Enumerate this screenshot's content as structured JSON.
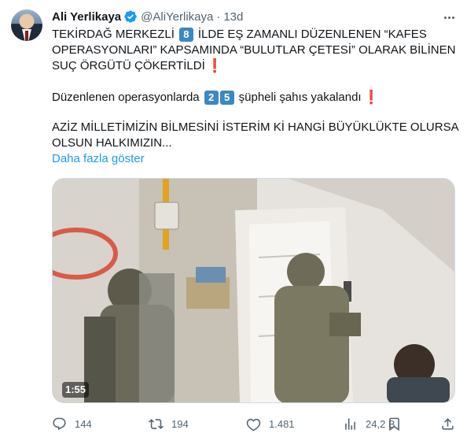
{
  "author": {
    "name": "Ali Yerlikaya",
    "handle": "@AliYerlikaya",
    "separator": "·",
    "time": "13d",
    "verified_icon": "verified-badge-icon",
    "accent": "#1d9bf0"
  },
  "tweet": {
    "line1_a": "TEKİRDAĞ MERKEZLİ",
    "line1_digit": "8",
    "line1_b": "İLDE EŞ ZAMANLI DÜZENLENEN “KAFES",
    "line2": "OPERASYONLARI” KAPSAMINDA “BULUTLAR ÇETESİ” OLARAK BİLİNEN",
    "line3": "SUÇ ÖRGÜTÜ ÇÖKERTİLDİ",
    "line3_mark": "❗",
    "line4_a": "Düzenlenen operasyonlarda",
    "line4_digit1": "2",
    "line4_digit2": "5",
    "line4_b": "şüpheli şahıs yakalandı",
    "line4_mark": "❗",
    "line5": "AZİZ MİLLETİMİZİN BİLMESİNİ İSTERİM Kİ HANGİ BÜYÜKLÜKTE OLURSA",
    "line6": "OLSUN HALKIMIZIN...",
    "show_more": "Daha fazla göster"
  },
  "media": {
    "duration": "1:55",
    "type": "video"
  },
  "actions": {
    "replies": "144",
    "reposts": "194",
    "likes": "1.481",
    "views": "24,2 B"
  }
}
